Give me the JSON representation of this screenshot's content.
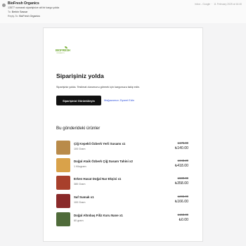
{
  "header": {
    "sender": "BioFresh Organics",
    "subject": "13577 numaralı siparişinize ait bir kargo yolda",
    "to_label": "To:",
    "to_value": "Berkin Sassar",
    "reply_label": "Reply-To:",
    "reply_value": "BioFresh Organics",
    "folder": "Inbox - Google",
    "date": "11 February 2025 at 16:40"
  },
  "logo": {
    "text": "BIOFRESH",
    "sub": "ORGANICS"
  },
  "main": {
    "heading": "Siparişiniz yolda",
    "description": "Siparişiniz yolda. Teslimat durumunu görmek için kargonuzu takip edin.",
    "primary_button": "Siparişinizi Görüntüleyin",
    "link": "Mağazamızı Ziyaret Edin"
  },
  "shipment": {
    "title": "Bu gönderideki ürünler",
    "items": [
      {
        "name": "Çiğ Kepekli Özberk Yerli Susamı x1",
        "qty": "100 Gram",
        "old_price": "₺175.00",
        "price": "₺140.00",
        "thumb_color": "#b98b4a"
      },
      {
        "name": "Doğal Ataik Özberk Çiğ Susam Tahini x2",
        "qty": "1 Kilogram",
        "old_price": "₺643.20",
        "price": "₺418.00",
        "thumb_color": "#d9a24a"
      },
      {
        "name": "Erken Hasat Doğal Nar Ekşisi x1",
        "qty": "380 Gram",
        "old_price": "₺580.00",
        "price": "₺358.00",
        "thumb_color": "#a8402c"
      },
      {
        "name": "Saf Sumak x1",
        "qty": "100 Gram",
        "old_price": "₺265.00",
        "price": "₺166.00",
        "thumb_color": "#8a2a2a"
      },
      {
        "name": "Doğal Altınbaş Filiz Kuru Nane x1",
        "qty": "60 gram",
        "old_price": "₺158.00",
        "price": "₺0.00",
        "thumb_color": "#4f6b3a"
      }
    ]
  }
}
